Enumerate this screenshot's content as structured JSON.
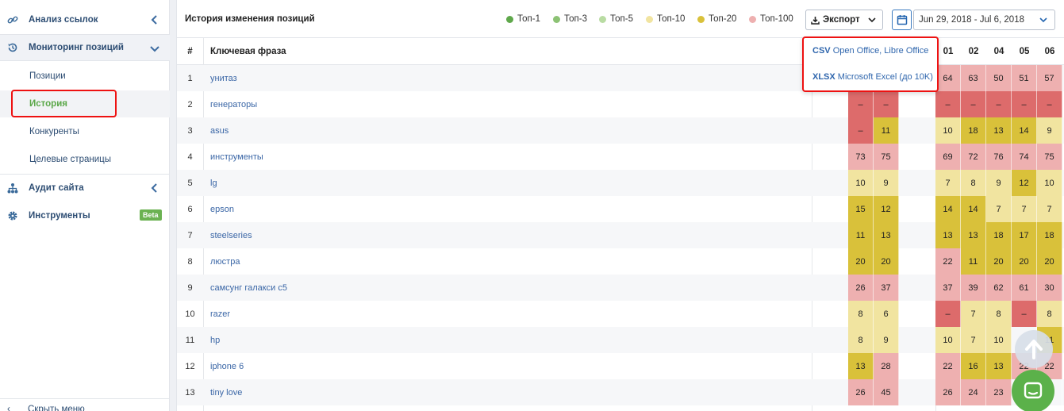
{
  "colors": {
    "top1": "#5fa84b",
    "top3": "#8cc274",
    "top5": "#b9dca3",
    "top10": "#f1e4a0",
    "top20": "#d9c13a",
    "top100": "#eeb0b0",
    "none": "#dd6b6b",
    "accent": "#2f66ad",
    "highlight": "#e11111"
  },
  "sidebar": {
    "items": [
      {
        "label": "Анализ ссылок",
        "icon": "link-icon"
      },
      {
        "label": "Мониторинг позиций",
        "icon": "history-icon"
      },
      {
        "label": "Аудит сайта",
        "icon": "sitemap-icon"
      },
      {
        "label": "Инструменты",
        "icon": "gear-icon"
      }
    ],
    "subitems": [
      "Позиции",
      "История",
      "Конкуренты",
      "Целевые страницы"
    ],
    "badge": "Beta",
    "hide_menu": "Скрыть меню"
  },
  "toolbar": {
    "title": "История изменения позиций",
    "legend": [
      "Топ-1",
      "Топ-3",
      "Топ-5",
      "Топ-10",
      "Топ-20",
      "Топ-100"
    ],
    "export_label": "Экспорт",
    "date_range": "Jun 29, 2018 - Jul 6, 2018"
  },
  "export_menu": [
    {
      "format": "CSV",
      "desc": "Open Office, Libre Office"
    },
    {
      "format": "XLSX",
      "desc": "Microsoft Excel (до 10K)"
    }
  ],
  "table": {
    "col_num": "#",
    "col_keyword": "Ключевая фраза",
    "date_headers": [
      "01",
      "02",
      "04",
      "05",
      "06"
    ],
    "rows": [
      {
        "n": "1",
        "kw": "унитаз",
        "a": [
          "",
          ""
        ],
        "b": [
          "64",
          "63",
          "50",
          "51",
          "57"
        ]
      },
      {
        "n": "2",
        "kw": "генераторы",
        "a": [
          "–",
          "–"
        ],
        "b": [
          "–",
          "–",
          "–",
          "–",
          "–"
        ]
      },
      {
        "n": "3",
        "kw": "asus",
        "a": [
          "–",
          "11"
        ],
        "b": [
          "10",
          "18",
          "13",
          "14",
          "9"
        ]
      },
      {
        "n": "4",
        "kw": "инструменты",
        "a": [
          "73",
          "75"
        ],
        "b": [
          "69",
          "72",
          "76",
          "74",
          "75"
        ]
      },
      {
        "n": "5",
        "kw": "lg",
        "a": [
          "10",
          "9"
        ],
        "b": [
          "7",
          "8",
          "9",
          "12",
          "10"
        ]
      },
      {
        "n": "6",
        "kw": "epson",
        "a": [
          "15",
          "12"
        ],
        "b": [
          "14",
          "14",
          "7",
          "7",
          "7"
        ]
      },
      {
        "n": "7",
        "kw": "steelseries",
        "a": [
          "11",
          "13"
        ],
        "b": [
          "13",
          "13",
          "18",
          "17",
          "18"
        ]
      },
      {
        "n": "8",
        "kw": "люстра",
        "a": [
          "20",
          "20"
        ],
        "b": [
          "22",
          "11",
          "20",
          "20",
          "20"
        ]
      },
      {
        "n": "9",
        "kw": "самсунг галакси с5",
        "a": [
          "26",
          "37"
        ],
        "b": [
          "37",
          "39",
          "62",
          "61",
          "30"
        ]
      },
      {
        "n": "10",
        "kw": "razer",
        "a": [
          "8",
          "6"
        ],
        "b": [
          "–",
          "7",
          "8",
          "–",
          "8"
        ]
      },
      {
        "n": "11",
        "kw": "hp",
        "a": [
          "8",
          "9"
        ],
        "b": [
          "10",
          "7",
          "10",
          "",
          "11"
        ]
      },
      {
        "n": "12",
        "kw": "iphone 6",
        "a": [
          "13",
          "28"
        ],
        "b": [
          "22",
          "16",
          "13",
          "22",
          "22"
        ]
      },
      {
        "n": "13",
        "kw": "tiny love",
        "a": [
          "26",
          "45"
        ],
        "b": [
          "26",
          "24",
          "23",
          "",
          ""
        ]
      }
    ]
  }
}
